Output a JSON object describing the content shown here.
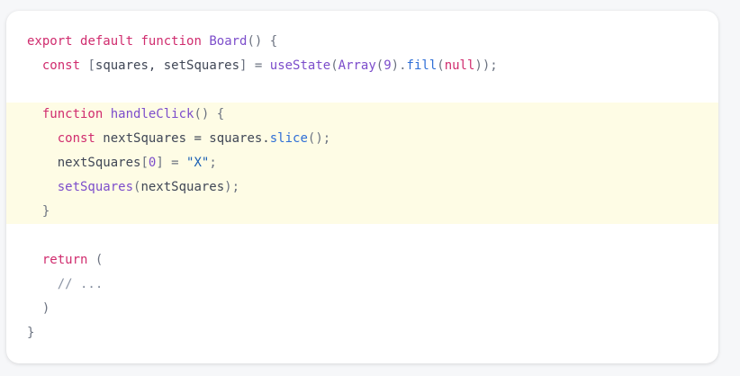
{
  "code": {
    "lines": [
      {
        "tokens": [
          {
            "t": "export",
            "c": "kw"
          },
          {
            "t": " "
          },
          {
            "t": "default",
            "c": "kw"
          },
          {
            "t": " "
          },
          {
            "t": "function",
            "c": "kw"
          },
          {
            "t": " "
          },
          {
            "t": "Board",
            "c": "fn"
          },
          {
            "t": "() {",
            "c": "op"
          }
        ]
      },
      {
        "tokens": [
          {
            "t": "  "
          },
          {
            "t": "const",
            "c": "kw"
          },
          {
            "t": " "
          },
          {
            "t": "[",
            "c": "op"
          },
          {
            "t": "squares, setSquares"
          },
          {
            "t": "] = ",
            "c": "op"
          },
          {
            "t": "useState",
            "c": "fn"
          },
          {
            "t": "(",
            "c": "op"
          },
          {
            "t": "Array",
            "c": "fn"
          },
          {
            "t": "(",
            "c": "op"
          },
          {
            "t": "9",
            "c": "nm"
          },
          {
            "t": ").",
            "c": "op"
          },
          {
            "t": "fill",
            "c": "pr"
          },
          {
            "t": "(",
            "c": "op"
          },
          {
            "t": "null",
            "c": "kw"
          },
          {
            "t": "));",
            "c": "op"
          }
        ]
      },
      {
        "tokens": []
      },
      {
        "highlight": true,
        "tokens": [
          {
            "t": "  "
          },
          {
            "t": "function",
            "c": "kw"
          },
          {
            "t": " "
          },
          {
            "t": "handleClick",
            "c": "fn"
          },
          {
            "t": "() {",
            "c": "op"
          }
        ]
      },
      {
        "highlight": true,
        "tokens": [
          {
            "t": "    "
          },
          {
            "t": "const",
            "c": "kw"
          },
          {
            "t": " nextSquares = squares."
          },
          {
            "t": "slice",
            "c": "pr"
          },
          {
            "t": "();",
            "c": "op"
          }
        ]
      },
      {
        "highlight": true,
        "tokens": [
          {
            "t": "    nextSquares"
          },
          {
            "t": "[",
            "c": "op"
          },
          {
            "t": "0",
            "c": "nm"
          },
          {
            "t": "] = ",
            "c": "op"
          },
          {
            "t": "\"X\"",
            "c": "st"
          },
          {
            "t": ";",
            "c": "op"
          }
        ]
      },
      {
        "highlight": true,
        "tokens": [
          {
            "t": "    "
          },
          {
            "t": "setSquares",
            "c": "fn"
          },
          {
            "t": "(",
            "c": "op"
          },
          {
            "t": "nextSquares"
          },
          {
            "t": ");",
            "c": "op"
          }
        ]
      },
      {
        "highlight": true,
        "tokens": [
          {
            "t": "  "
          },
          {
            "t": "}",
            "c": "op"
          }
        ]
      },
      {
        "tokens": []
      },
      {
        "tokens": [
          {
            "t": "  "
          },
          {
            "t": "return",
            "c": "kw"
          },
          {
            "t": " "
          },
          {
            "t": "(",
            "c": "op"
          }
        ]
      },
      {
        "tokens": [
          {
            "t": "    "
          },
          {
            "t": "// ...",
            "c": "cm"
          }
        ]
      },
      {
        "tokens": [
          {
            "t": "  "
          },
          {
            "t": ")",
            "c": "op"
          }
        ]
      },
      {
        "tokens": [
          {
            "t": "}",
            "c": "op"
          }
        ]
      }
    ]
  },
  "colors": {
    "keyword": "#d02c6e",
    "function": "#7c4dcb",
    "property": "#2f6fd6",
    "string": "#1a5fb4",
    "highlight_bg": "#fefce5"
  }
}
